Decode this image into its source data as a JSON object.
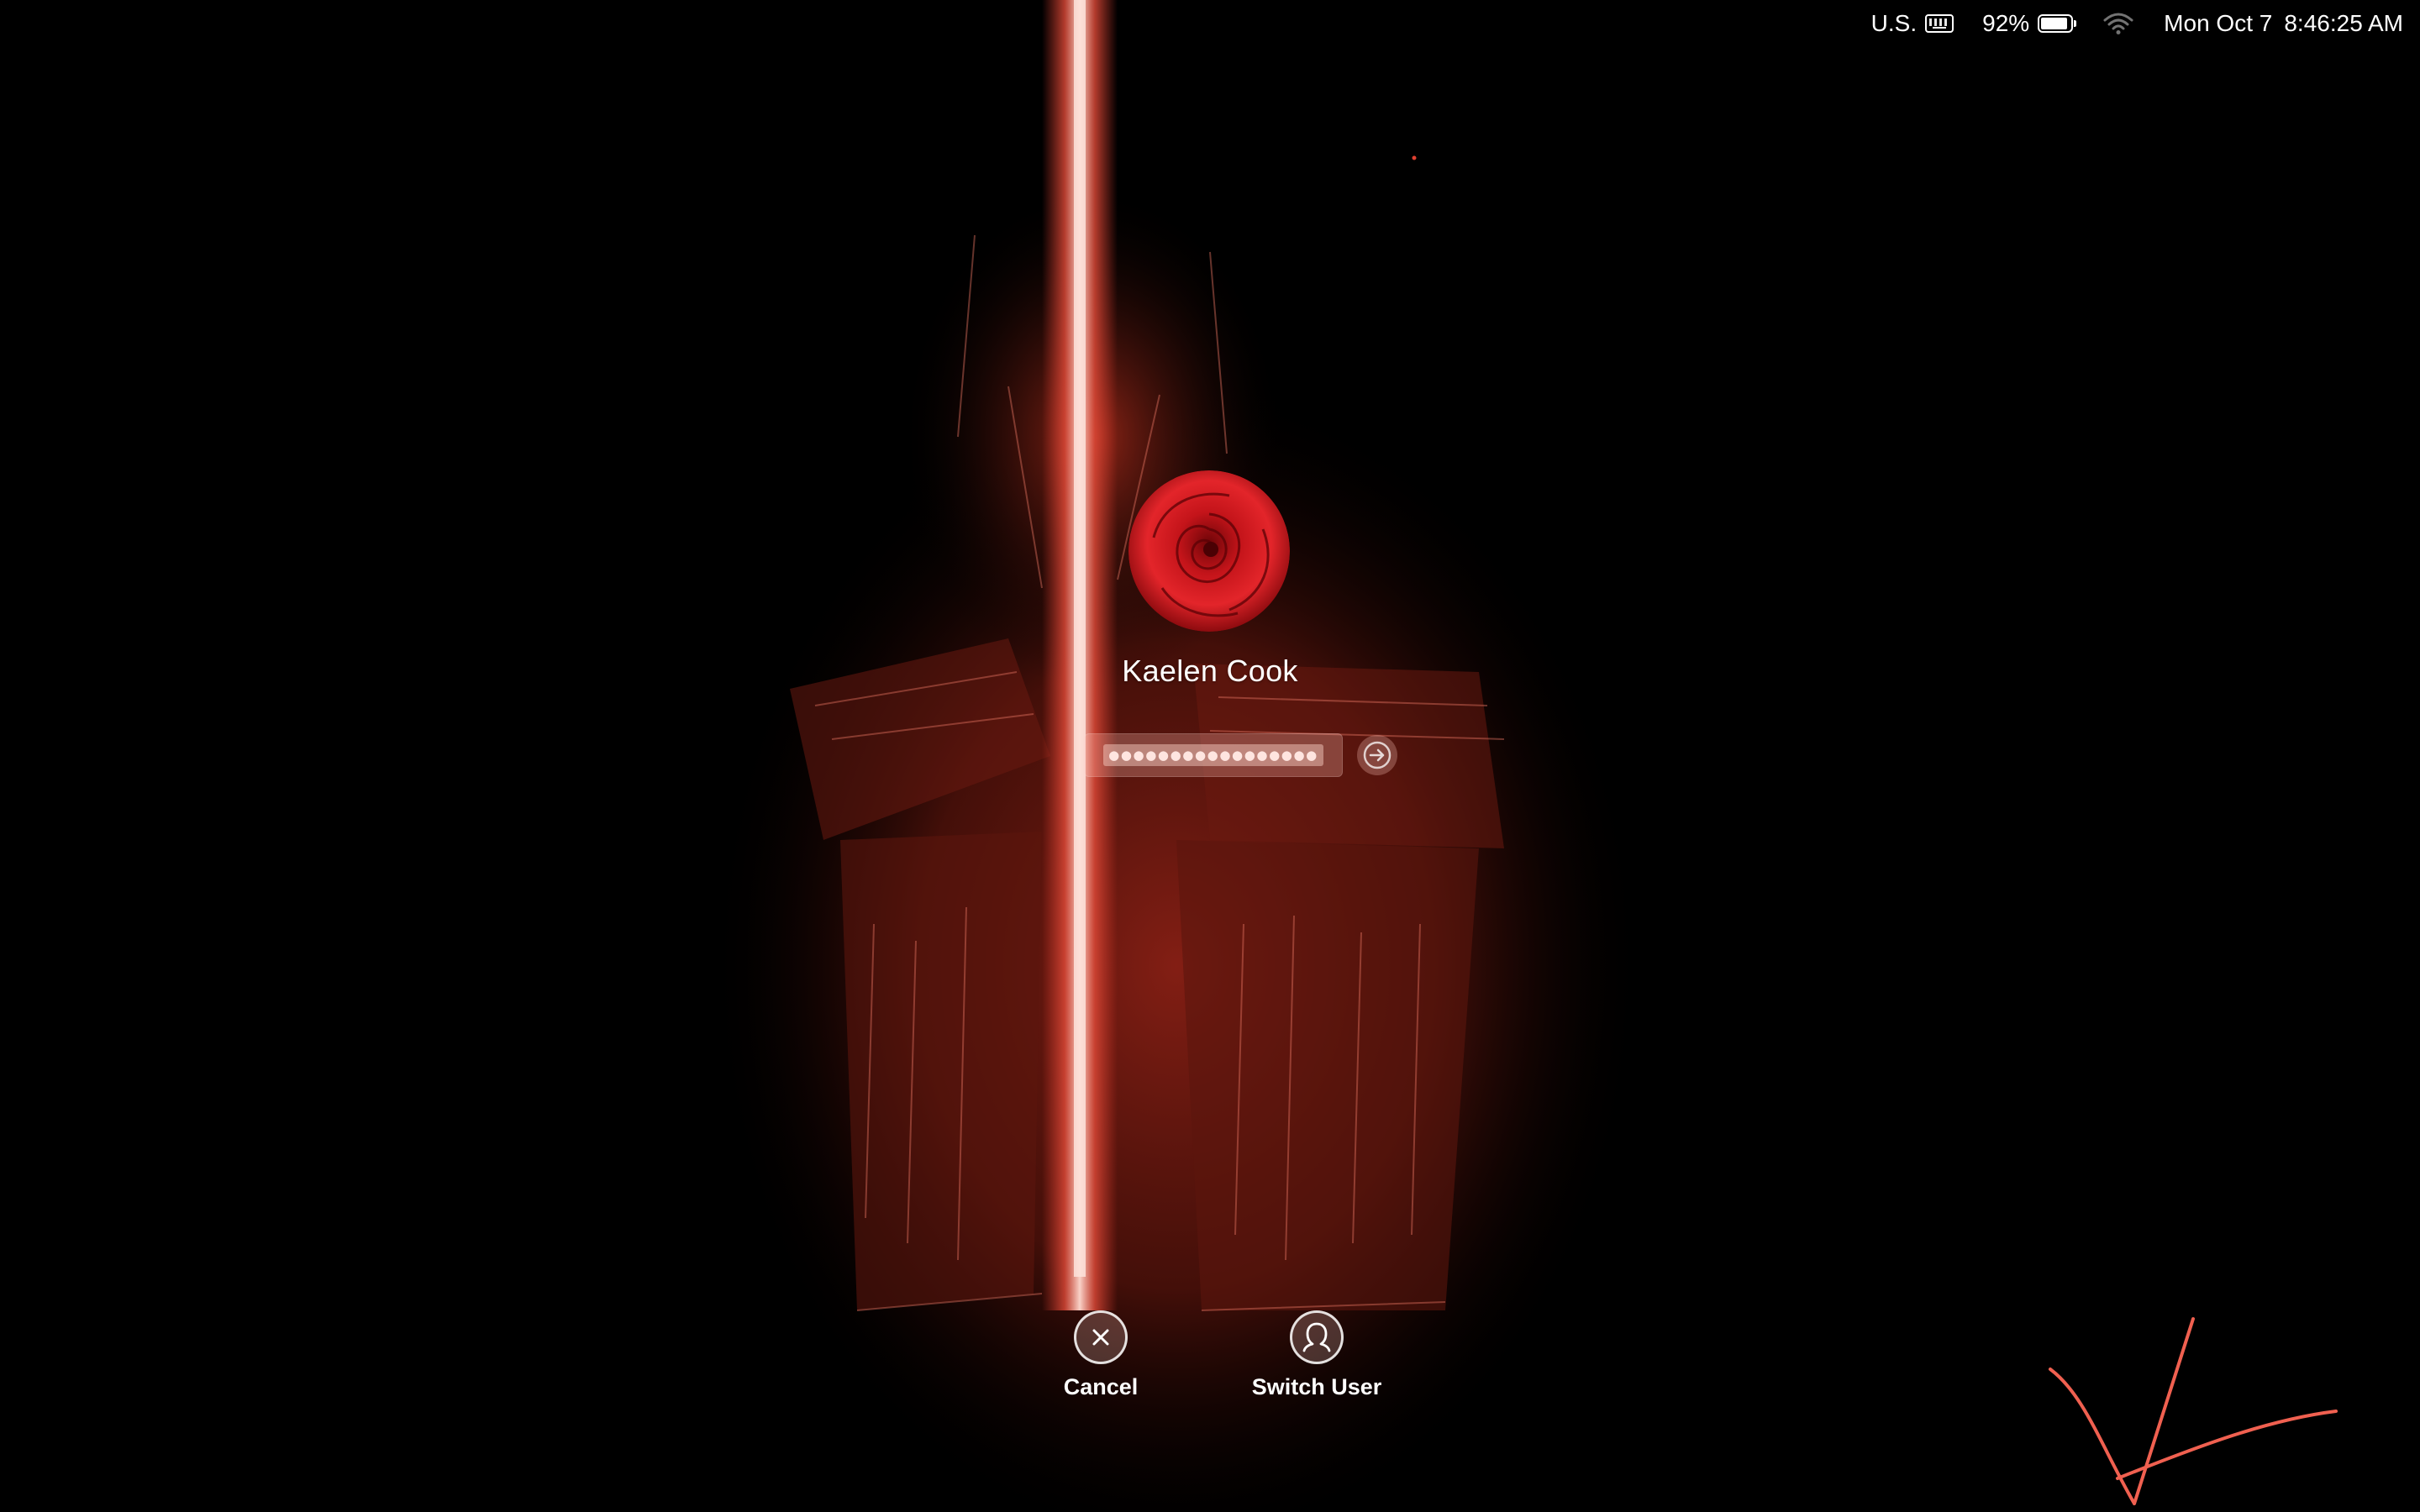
{
  "menubar": {
    "input_source": "U.S.",
    "battery_percent": "92%",
    "battery_level": 0.92,
    "date": "Mon Oct 7",
    "time": "8:46:25 AM"
  },
  "login": {
    "user_name": "Kaelen Cook",
    "password_mask": "●●●●●●●●●●●●●●●●●",
    "submit_icon": "arrow-right-icon"
  },
  "actions": {
    "cancel_label": "Cancel",
    "cancel_icon": "x-circle-icon",
    "switch_user_label": "Switch User",
    "switch_user_icon": "user-silhouette-icon"
  },
  "colors": {
    "background": "#000000",
    "accent": "#e8473c",
    "light_beam": "#f8c8c0"
  }
}
